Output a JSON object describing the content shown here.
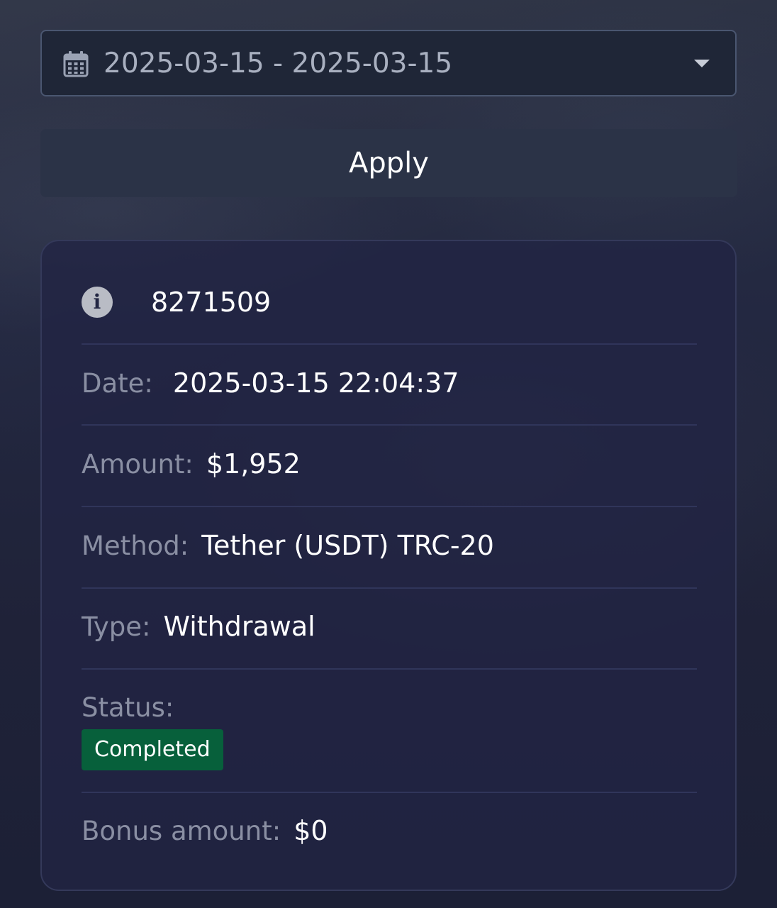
{
  "filter": {
    "date_range": "2025-03-15 - 2025-03-15",
    "apply_label": "Apply"
  },
  "transaction": {
    "id": "8271509",
    "date_label": "Date:",
    "date_value": "2025-03-15 22:04:37",
    "amount_label": "Amount:",
    "amount_value": "$1,952",
    "method_label": "Method:",
    "method_value": "Tether (USDT) TRC-20",
    "type_label": "Type:",
    "type_value": "Withdrawal",
    "status_label": "Status:",
    "status_value": "Completed",
    "bonus_label": "Bonus amount:",
    "bonus_value": "$0"
  },
  "icons": {
    "calendar": "calendar-icon",
    "caret": "chevron-down-icon",
    "info": "info-icon"
  },
  "colors": {
    "status_completed": "#07603b",
    "label": "#8a8fa3",
    "value": "#ffffff"
  }
}
